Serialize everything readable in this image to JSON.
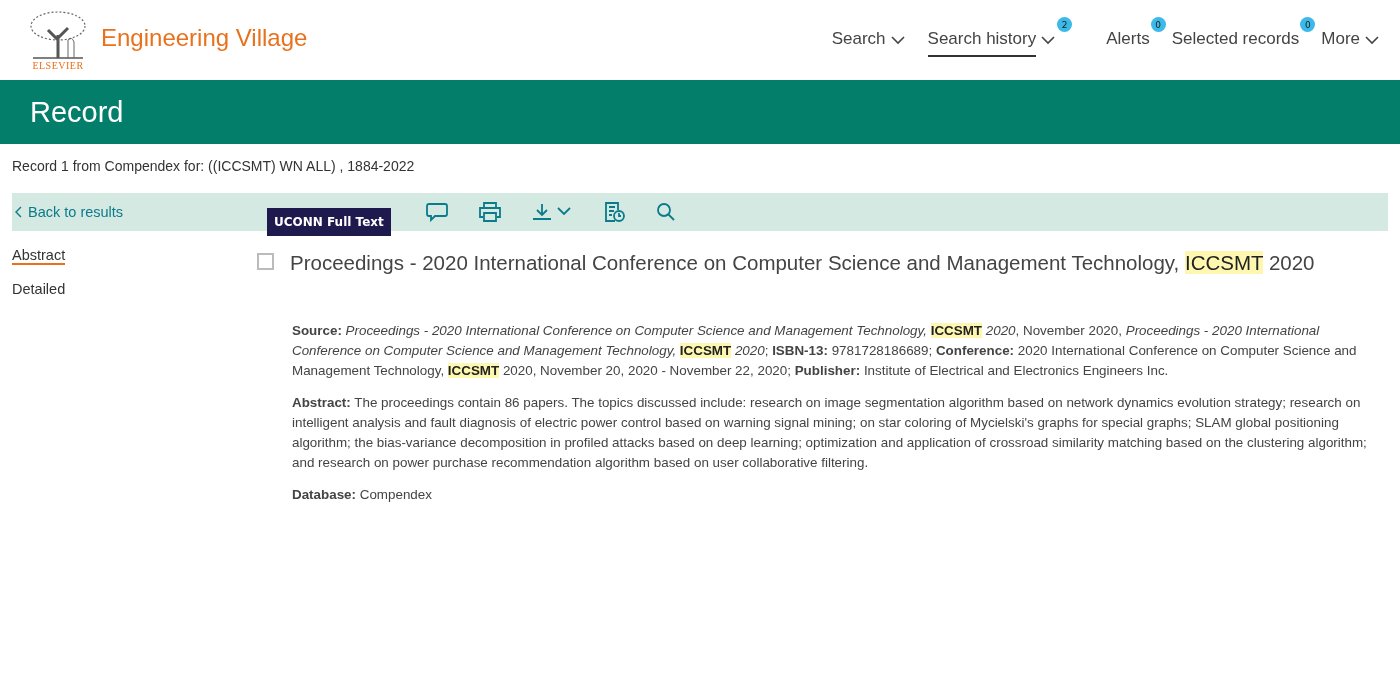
{
  "header": {
    "brand_mark": "ELSEVIER",
    "product": "Engineering Village",
    "nav": [
      {
        "label": "Search",
        "dropdown": true,
        "selected": false
      },
      {
        "label": "Search history",
        "dropdown": true,
        "selected": true,
        "badge": "2"
      },
      {
        "label": "Alerts",
        "dropdown": false,
        "selected": false,
        "badge": "0"
      },
      {
        "label": "Selected records",
        "dropdown": false,
        "selected": false,
        "badge": "0"
      },
      {
        "label": "More",
        "dropdown": true,
        "selected": false
      }
    ]
  },
  "page_title": "Record",
  "record_info": "Record 1 from Compendex for: ((ICCSMT) WN ALL) , 1884-2022",
  "toolbar": {
    "back": "Back to results",
    "full_text": "UCONN Full Text",
    "tools": [
      {
        "kind": "comment"
      },
      {
        "kind": "print"
      },
      {
        "kind": "download"
      },
      {
        "kind": "history"
      },
      {
        "kind": "search"
      }
    ]
  },
  "views": [
    {
      "label": "Abstract",
      "selected": true
    },
    {
      "label": "Detailed",
      "selected": false
    }
  ],
  "record": {
    "checked": false,
    "title": [
      {
        "kind": "plain",
        "text": "Proceedings - 2020 International Conference on Computer Science and Management Technology, "
      },
      {
        "kind": "mark",
        "text": "ICCSMT"
      },
      {
        "kind": "plain",
        "text": " 2020"
      }
    ],
    "source": [
      {
        "kind": "label",
        "text": "Source:"
      },
      {
        "kind": "italic",
        "text": " Proceedings - 2020 International Conference on Computer Science and Management Technology, "
      },
      {
        "kind": "mark",
        "text": "ICCSMT"
      },
      {
        "kind": "italic",
        "text": " 2020"
      },
      {
        "kind": "plain",
        "text": ", November 2020, "
      },
      {
        "kind": "italic",
        "text": "Proceedings - 2020 International Conference on Computer Science and Management Technology, "
      },
      {
        "kind": "mark",
        "text": "ICCSMT"
      },
      {
        "kind": "italic",
        "text": " 2020"
      },
      {
        "kind": "plain",
        "text": ";  "
      },
      {
        "kind": "label",
        "text": "ISBN-13:"
      },
      {
        "kind": "plain",
        "text": " 9781728186689; "
      },
      {
        "kind": "label",
        "text": "Conference:"
      },
      {
        "kind": "plain",
        "text": " 2020 International Conference on Computer Science and Management Technology, "
      },
      {
        "kind": "mark",
        "text": "ICCSMT"
      },
      {
        "kind": "plain",
        "text": " 2020, November 20, 2020 - November 22, 2020; "
      },
      {
        "kind": "label",
        "text": "Publisher:"
      },
      {
        "kind": "plain",
        "text": " Institute of Electrical and Electronics Engineers Inc."
      }
    ],
    "abstract": [
      {
        "kind": "label",
        "text": "Abstract:"
      },
      {
        "kind": "plain",
        "text": " The proceedings contain 86 papers. The topics discussed include: research on image segmentation algorithm based on network dynamics evolution strategy; research on intelligent analysis and fault diagnosis of electric power control based on warning signal mining; on star coloring of Mycielski's graphs for special graphs; SLAM global positioning algorithm; the bias-variance decomposition in profiled attacks based on deep learning; optimization and application of crossroad similarity matching based on the clustering algorithm; and research on power purchase recommendation algorithm based on user collaborative filtering."
      }
    ],
    "database": [
      {
        "kind": "label",
        "text": "Database:"
      },
      {
        "kind": "plain",
        "text": " Compendex"
      }
    ]
  }
}
